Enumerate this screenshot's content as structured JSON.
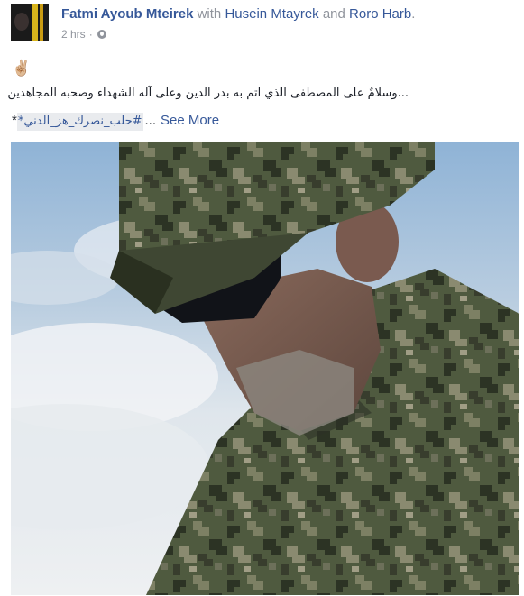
{
  "post": {
    "author": "Fatmi Ayoub Mteirek",
    "with_text": "with",
    "tagged": [
      "Husein Mtayrek",
      "Roro Harb"
    ],
    "and_text": "and",
    "end_period": ".",
    "time": "2 hrs",
    "dot": "·",
    "privacy_icon": "globe-icon",
    "emoji": "✌🏼",
    "text_arabic": "...وسلامٌ على المصطفى الذي اتم به بدر الدين وعلى آله الشهداء وصحبه المجاهدين",
    "star_open": "*",
    "hashtag": "#حلب_نصرك_هز_الدني",
    "star_close": "*",
    "ellipsis": "...",
    "see_more": "See More",
    "photo_icon": "soldier-photo"
  }
}
